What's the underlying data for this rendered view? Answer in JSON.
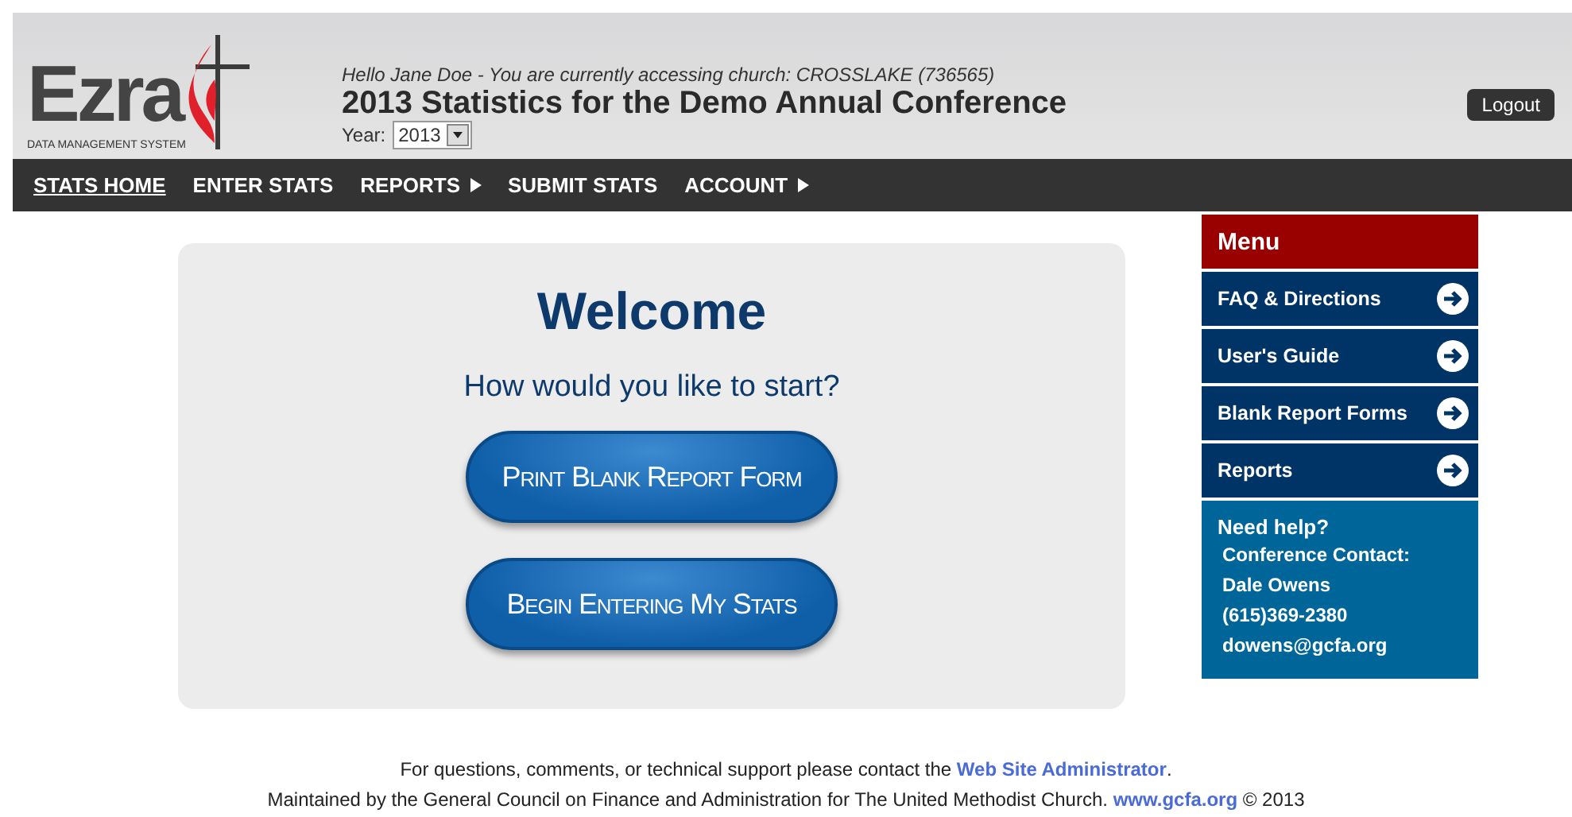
{
  "header": {
    "logo_text": "Ezra",
    "logo_subtitle": "DATA MANAGEMENT SYSTEM",
    "greeting": "Hello Jane Doe - You are currently accessing church: CROSSLAKE (736565)",
    "title": "2013 Statistics for the Demo Annual Conference",
    "year_label": "Year:",
    "year_value": "2013",
    "logout": "Logout"
  },
  "nav": [
    {
      "label": "STATS HOME",
      "selected": true,
      "submenu": false
    },
    {
      "label": "ENTER STATS",
      "selected": false,
      "submenu": false
    },
    {
      "label": "REPORTS",
      "selected": false,
      "submenu": true
    },
    {
      "label": "SUBMIT STATS",
      "selected": false,
      "submenu": false
    },
    {
      "label": "ACCOUNT",
      "selected": false,
      "submenu": true
    }
  ],
  "welcome": {
    "title": "Welcome",
    "prompt": "How would you like to start?",
    "buttons": [
      "Print Blank Report Form",
      "Begin Entering My Stats"
    ]
  },
  "sidebar": {
    "title": "Menu",
    "items": [
      "FAQ & Directions",
      "User's Guide",
      "Blank Report Forms",
      "Reports"
    ],
    "help": {
      "heading": "Need help?",
      "lines": [
        "Conference Contact:",
        "Dale Owens",
        "(615)369-2380",
        "dowens@gcfa.org"
      ]
    }
  },
  "footer": [
    {
      "before": "For questions, comments, or technical support please contact the ",
      "link": "Web Site Administrator",
      "after": "."
    },
    {
      "before": "Maintained by the General Council on Finance and Administration for The United Methodist Church. ",
      "link": "www.gcfa.org",
      "after": " © 2013"
    }
  ]
}
